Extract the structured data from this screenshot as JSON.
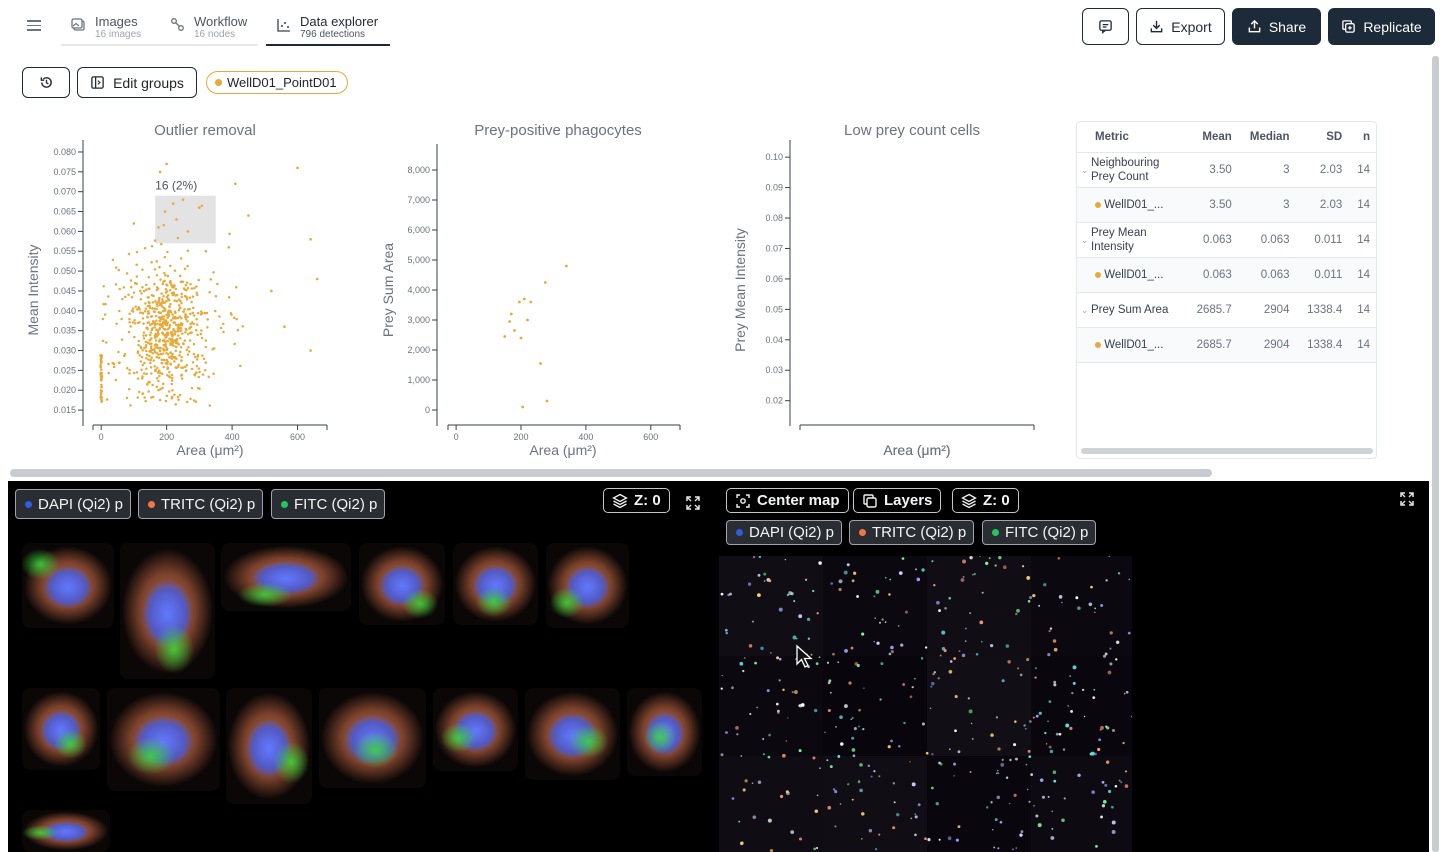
{
  "nav": {
    "tabs": [
      {
        "label": "Images",
        "sub": "16 images"
      },
      {
        "label": "Workflow",
        "sub": "16 nodes"
      },
      {
        "label": "Data explorer",
        "sub": "796 detections"
      }
    ]
  },
  "header_actions": {
    "export": "Export",
    "share": "Share",
    "replicate": "Replicate"
  },
  "toolbar": {
    "edit_groups": "Edit groups",
    "group_chip": "WellD01_PointD01",
    "group_color": "#e8a93b"
  },
  "charts": {
    "outlier_title": "Outlier removal",
    "outlier_selection_label": "16 (2%)",
    "prey_pos_title": "Prey-positive phagocytes",
    "low_prey_title": "Low prey count cells"
  },
  "chart_data": [
    {
      "type": "scatter",
      "title": "Outlier removal",
      "xlabel": "Area (μm²)",
      "ylabel": "Mean Intensity",
      "xticks": [
        "0",
        "200",
        "400",
        "600"
      ],
      "yticks": [
        "0.015",
        "0.020",
        "0.025",
        "0.030",
        "0.035",
        "0.040",
        "0.045",
        "0.050",
        "0.055",
        "0.060",
        "0.065",
        "0.070",
        "0.075",
        "0.080"
      ],
      "xlim": [
        -25,
        690
      ],
      "ylim": [
        0.012,
        0.081
      ],
      "selection": {
        "x": [
          165,
          350
        ],
        "y": [
          0.057,
          0.069
        ],
        "label": "16 (2%)"
      },
      "points_note": "about 796 detections clustered around Area 150-250, Mean Intensity 0.025-0.045",
      "series": [
        {
          "color": "#e8a93b"
        }
      ]
    },
    {
      "type": "scatter",
      "title": "Prey-positive phagocytes",
      "xlabel": "Area (μm²)",
      "ylabel": "Prey Sum Area",
      "xticks": [
        "0",
        "200",
        "400",
        "600"
      ],
      "yticks": [
        "0",
        "1,000",
        "2,000",
        "3,000",
        "4,000",
        "5,000",
        "6,000",
        "7,000",
        "8,000"
      ],
      "xlim": [
        -25,
        690
      ],
      "ylim": [
        -400,
        8600
      ],
      "points": [
        [
          150,
          2450
        ],
        [
          180,
          2650
        ],
        [
          165,
          2950
        ],
        [
          170,
          3200
        ],
        [
          195,
          3600
        ],
        [
          210,
          3700
        ],
        [
          230,
          3600
        ],
        [
          220,
          3000
        ],
        [
          200,
          2400
        ],
        [
          260,
          1550
        ],
        [
          280,
          300
        ],
        [
          205,
          100
        ],
        [
          340,
          4800
        ],
        [
          275,
          4250
        ]
      ],
      "series": [
        {
          "color": "#e8a93b"
        }
      ]
    },
    {
      "type": "scatter",
      "title": "Low prey count cells",
      "xlabel": "Area (μm²)",
      "ylabel": "Prey Mean Intensity",
      "yticks": [
        "0.02",
        "0.03",
        "0.04",
        "0.05",
        "0.06",
        "0.07",
        "0.08",
        "0.09",
        "0.10"
      ],
      "ylim": [
        0.013,
        0.103
      ],
      "points": []
    }
  ],
  "stats_table": {
    "headers": [
      "Metric",
      "Mean",
      "Median",
      "SD",
      "n"
    ],
    "rows": [
      {
        "metric": "Neighbouring Prey Count",
        "mean": "3.50",
        "median": "3",
        "sd": "2.03",
        "n": "14",
        "child": {
          "group": "WellD01_...",
          "mean": "3.50",
          "median": "3",
          "sd": "2.03",
          "n": "14"
        }
      },
      {
        "metric": "Prey Mean Intensity",
        "mean": "0.063",
        "median": "0.063",
        "sd": "0.011",
        "n": "14",
        "child": {
          "group": "WellD01_...",
          "mean": "0.063",
          "median": "0.063",
          "sd": "0.011",
          "n": "14"
        }
      },
      {
        "metric": "Prey Sum Area",
        "mean": "2685.7",
        "median": "2904",
        "sd": "1338.4",
        "n": "14",
        "child": {
          "group": "WellD01_...",
          "mean": "2685.7",
          "median": "2904",
          "sd": "1338.4",
          "n": "14"
        }
      }
    ]
  },
  "viewer": {
    "channels": [
      {
        "label": "DAPI (Qi2) p",
        "color": "#2f5be0"
      },
      {
        "label": "TRITC (Qi2) p",
        "color": "#f07848"
      },
      {
        "label": "FITC (Qi2) p",
        "color": "#22c55e"
      }
    ],
    "z_label": "Z: 0",
    "center_map": "Center map",
    "layers": "Layers"
  }
}
